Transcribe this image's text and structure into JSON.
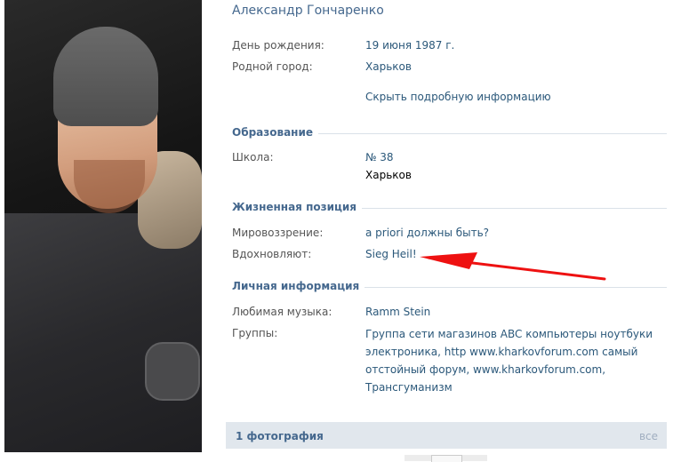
{
  "profile": {
    "name": "Александр Гончаренко",
    "birthday_label": "День рождения:",
    "birthday_value": "19 июня 1987 г.",
    "hometown_label": "Родной город:",
    "hometown_value": "Харьков",
    "hide_details": "Скрыть подробную информацию"
  },
  "education": {
    "title": "Образование",
    "school_label": "Школа:",
    "school_value": "№ 38",
    "school_city": "Харьков"
  },
  "life_position": {
    "title": "Жизненная позиция",
    "worldview_label": "Мировоззрение:",
    "worldview_value": "a priori должны быть?",
    "inspired_label": "Вдохновляют:",
    "inspired_value": "Sieg Heil!"
  },
  "personal": {
    "title": "Личная информация",
    "music_label": "Любимая музыка:",
    "music_value": "Ramm Stein",
    "groups_label": "Группы:",
    "groups_lines": [
      "Группа сети магазинов ABC компьютеры ноутбуки",
      "электроника, http www.kharkovforum.com самый",
      "отстойный форум, www.kharkovforum.com,",
      "Трансгуманизм"
    ]
  },
  "photos": {
    "title": "1 фотография",
    "all_link": "все"
  },
  "colors": {
    "link": "#2b587a",
    "header": "#45688e",
    "annotation_arrow": "#ee1111"
  }
}
